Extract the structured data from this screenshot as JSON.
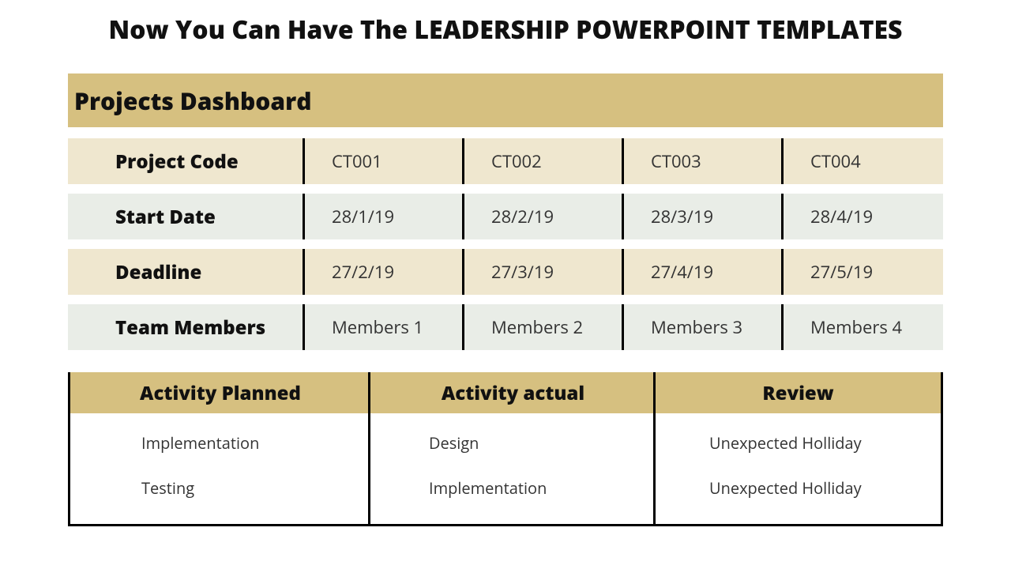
{
  "title": "Now You Can Have The LEADERSHIP POWERPOINT TEMPLATES",
  "dashboard": {
    "heading": "Projects Dashboard",
    "rows": {
      "project_code": {
        "label": "Project Code",
        "values": [
          "CT001",
          "CT002",
          "CT003",
          "CT004"
        ]
      },
      "start_date": {
        "label": "Start Date",
        "values": [
          "28/1/19",
          "28/2/19",
          "28/3/19",
          "28/4/19"
        ]
      },
      "deadline": {
        "label": "Deadline",
        "values": [
          "27/2/19",
          "27/3/19",
          "27/4/19",
          "27/5/19"
        ]
      },
      "team_members": {
        "label": "Team Members",
        "values": [
          "Members 1",
          "Members 2",
          "Members 3",
          "Members 4"
        ]
      }
    }
  },
  "activity": {
    "planned": {
      "header": "Activity Planned",
      "items": [
        "Implementation",
        "Testing"
      ]
    },
    "actual": {
      "header": "Activity actual",
      "items": [
        "Design",
        "Implementation"
      ]
    },
    "review": {
      "header": "Review",
      "items": [
        "Unexpected Holliday",
        "Unexpected Holliday"
      ]
    }
  },
  "colors": {
    "accent": "#d6c080",
    "row_odd": "#efe7cf",
    "row_even": "#e9ede7"
  },
  "chart_data": {
    "type": "table",
    "title": "Projects Dashboard",
    "columns": [
      "Project Code",
      "Start Date",
      "Deadline",
      "Team Members"
    ],
    "rows": [
      {
        "Project Code": "CT001",
        "Start Date": "28/1/19",
        "Deadline": "27/2/19",
        "Team Members": "Members 1"
      },
      {
        "Project Code": "CT002",
        "Start Date": "28/2/19",
        "Deadline": "27/3/19",
        "Team Members": "Members 2"
      },
      {
        "Project Code": "CT003",
        "Start Date": "28/3/19",
        "Deadline": "27/4/19",
        "Team Members": "Members 3"
      },
      {
        "Project Code": "CT004",
        "Start Date": "28/4/19",
        "Deadline": "27/5/19",
        "Team Members": "Members 4"
      }
    ]
  }
}
